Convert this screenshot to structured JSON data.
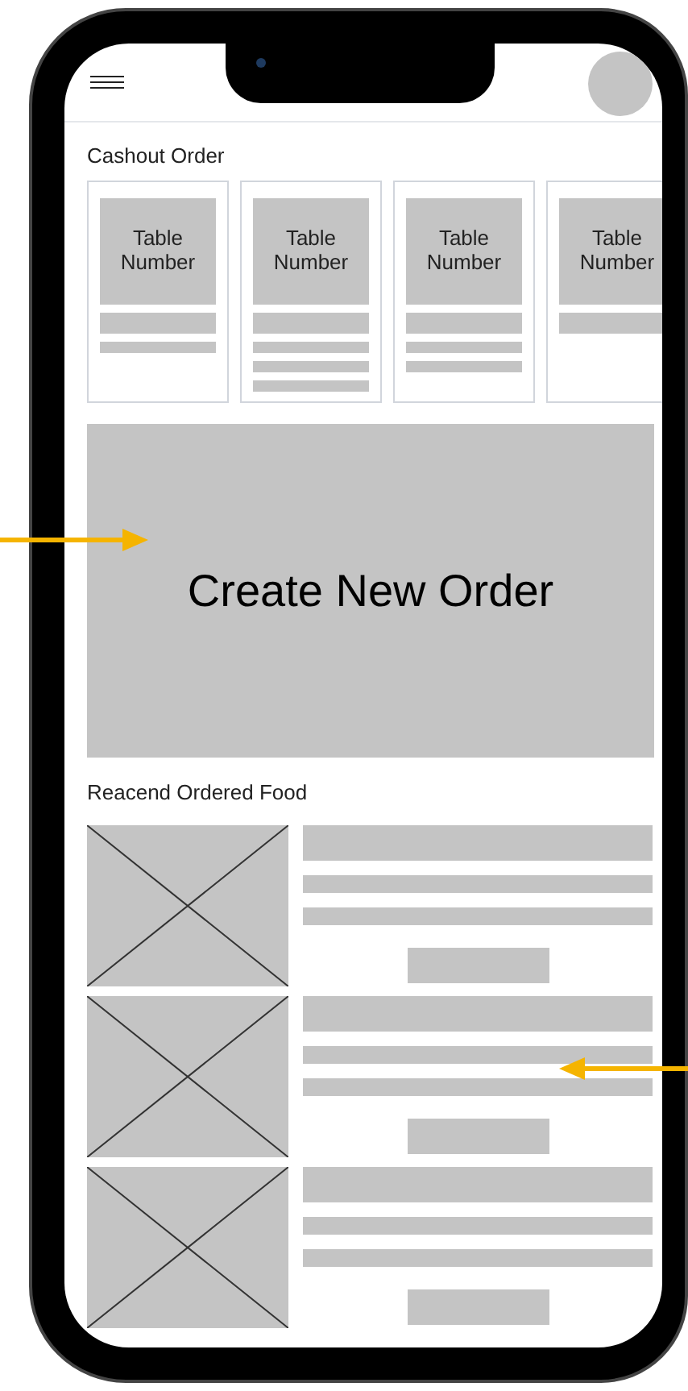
{
  "cashout_section": {
    "title": "Cashout Order"
  },
  "cashout_orders": [
    {
      "label": "Table Number",
      "bars": [
        {
          "kind": "wide"
        },
        {
          "kind": "thin"
        }
      ]
    },
    {
      "label": "Table Number",
      "bars": [
        {
          "kind": "wide"
        },
        {
          "kind": "thin"
        },
        {
          "kind": "thin"
        },
        {
          "kind": "thin"
        }
      ]
    },
    {
      "label": "Table Number",
      "bars": [
        {
          "kind": "wide"
        },
        {
          "kind": "thin"
        },
        {
          "kind": "thin"
        }
      ]
    },
    {
      "label": "Table Number",
      "bars": [
        {
          "kind": "wide"
        }
      ]
    }
  ],
  "create_button": {
    "label": "Create New Order"
  },
  "recent_section": {
    "title": "Reacend Ordered Food"
  },
  "recent_food": [
    {
      "bars": [
        {
          "kind": "wide"
        },
        {
          "kind": "thin"
        },
        {
          "kind": "thin"
        },
        {
          "kind": "button"
        }
      ]
    },
    {
      "bars": [
        {
          "kind": "wide"
        },
        {
          "kind": "thin"
        },
        {
          "kind": "thin"
        },
        {
          "kind": "button"
        }
      ]
    },
    {
      "bars": [
        {
          "kind": "wide"
        },
        {
          "kind": "thin"
        },
        {
          "kind": "thin"
        },
        {
          "kind": "button"
        }
      ]
    }
  ]
}
